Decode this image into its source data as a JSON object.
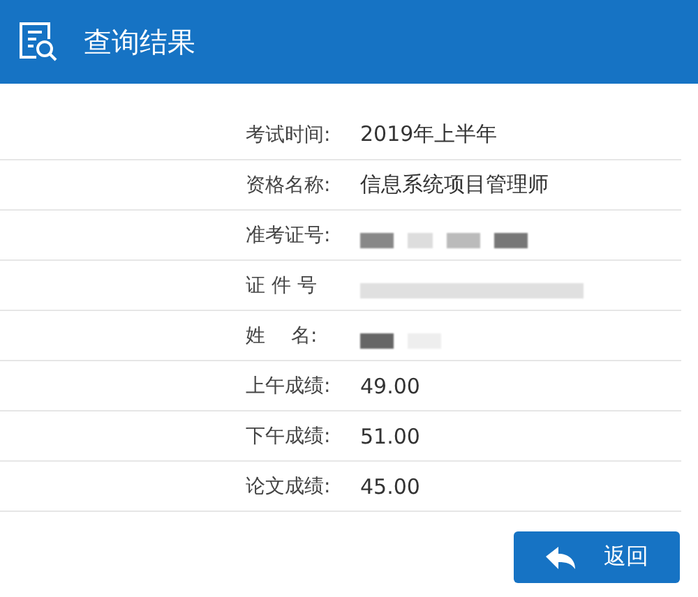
{
  "header": {
    "title": "查询结果"
  },
  "rows": [
    {
      "label": "考试时间:",
      "kind": "text",
      "value": "2019年上半年"
    },
    {
      "label": "资格名称:",
      "kind": "text",
      "value": "信息系统项目管理师"
    },
    {
      "label": "准考证号:",
      "kind": "redacted"
    },
    {
      "label": "证 件 号",
      "kind": "redacted"
    },
    {
      "label": "姓　 名:",
      "kind": "redacted"
    },
    {
      "label": "上午成绩:",
      "kind": "text",
      "value": "49.00"
    },
    {
      "label": "下午成绩:",
      "kind": "text",
      "value": "51.00"
    },
    {
      "label": "论文成绩:",
      "kind": "text",
      "value": "45.00"
    }
  ],
  "back_button": {
    "label": "返回"
  }
}
